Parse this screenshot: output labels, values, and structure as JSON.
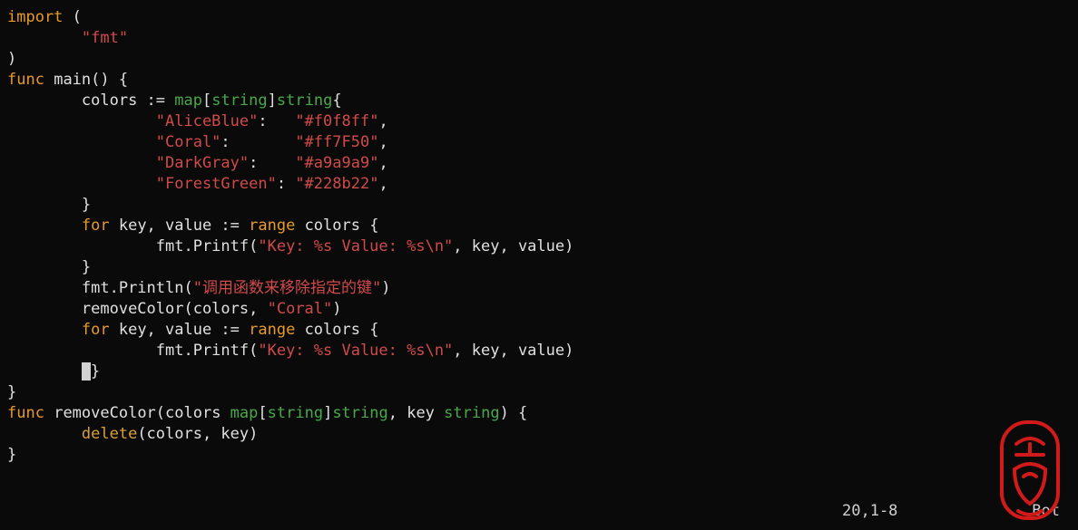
{
  "code": {
    "kw_import": "import",
    "paren_open": "(",
    "paren_close": ")",
    "fmt_pkg": "\"fmt\"",
    "kw_func": "func",
    "main": "main",
    "brace_open": "{",
    "brace_close": "}",
    "colors_decl_pre": "colors := ",
    "kw_map": "map",
    "lbracket": "[",
    "rbracket": "]",
    "typ_string": "string",
    "entries": [
      {
        "key": "\"AliceBlue\"",
        "sep": ":   ",
        "val": "\"#f0f8ff\"",
        "comma": ","
      },
      {
        "key": "\"Coral\"",
        "sep": ":       ",
        "val": "\"#ff7F50\"",
        "comma": ","
      },
      {
        "key": "\"DarkGray\"",
        "sep": ":    ",
        "val": "\"#a9a9a9\"",
        "comma": ","
      },
      {
        "key": "\"ForestGreen\"",
        "sep": ": ",
        "val": "\"#228b22\"",
        "comma": ","
      }
    ],
    "kw_for": "for",
    "for_vars": " key, value := ",
    "kw_range": "range",
    "for_tail": " colors {",
    "printf_call_pre": "fmt.Printf(",
    "printf_fmt": "\"Key: %s Value: %s\\n\"",
    "printf_tail": ", key, value)",
    "println_pre": "fmt.Println(",
    "println_str": "\"调用函数来移除指定的键\"",
    "println_tail": ")",
    "removeColor_call_pre": "removeColor(colors, ",
    "removeColor_arg": "\"Coral\"",
    "removeColor_tail": ")",
    "removeColor_def_pre": "removeColor(colors ",
    "removeColor_def_mid": ", key ",
    "removeColor_def_tail": ") {",
    "kw_delete": "delete",
    "delete_tail": "(colors, key)"
  },
  "status": {
    "pos": "20,1-8",
    "loc": "Bot"
  }
}
